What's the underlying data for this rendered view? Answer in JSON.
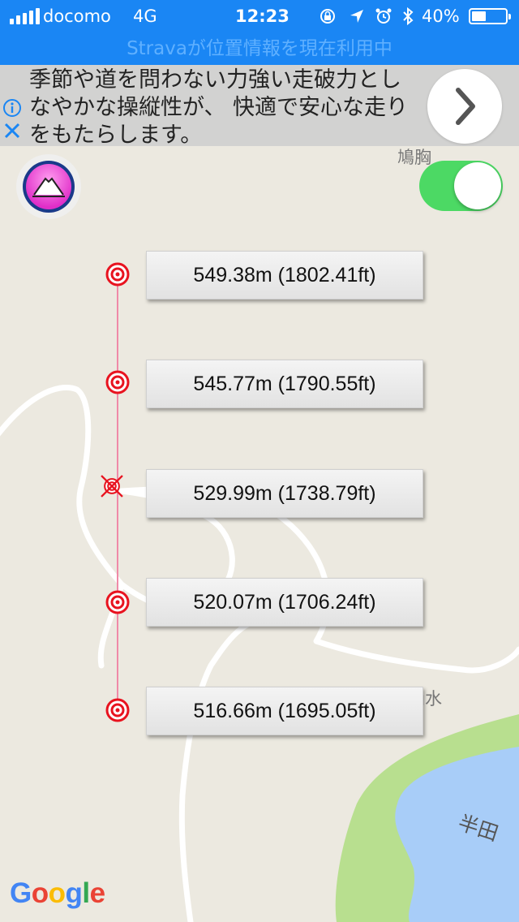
{
  "status_bar": {
    "carrier": "docomo",
    "network": "4G",
    "time": "12:23",
    "battery": "40%"
  },
  "location_banner": "Stravaが位置情報を現在利用中",
  "ad": {
    "text": "季節や道を問わない力強い走破力としなやかな操縦性が、 快適で安心な走りをもたらします。"
  },
  "map": {
    "labels": [
      "鳩胸",
      "涌水",
      "半田"
    ],
    "attribution": "Google",
    "colors": {
      "land": "#ece9e0",
      "road": "#ffffff",
      "water": "#a8cdf8",
      "park": "#b8df8f",
      "route": "#f08aa8",
      "marker": "#e8131f"
    }
  },
  "toggle": {
    "on": true,
    "color": "#4cd964"
  },
  "elevation_points": [
    {
      "label": "549.38m (1802.41ft)",
      "type": "target"
    },
    {
      "label": "545.77m (1790.55ft)",
      "type": "target"
    },
    {
      "label": "529.99m (1738.79ft)",
      "type": "crossed-target"
    },
    {
      "label": "520.07m (1706.24ft)",
      "type": "target"
    },
    {
      "label": "516.66m (1695.05ft)",
      "type": "target"
    }
  ]
}
